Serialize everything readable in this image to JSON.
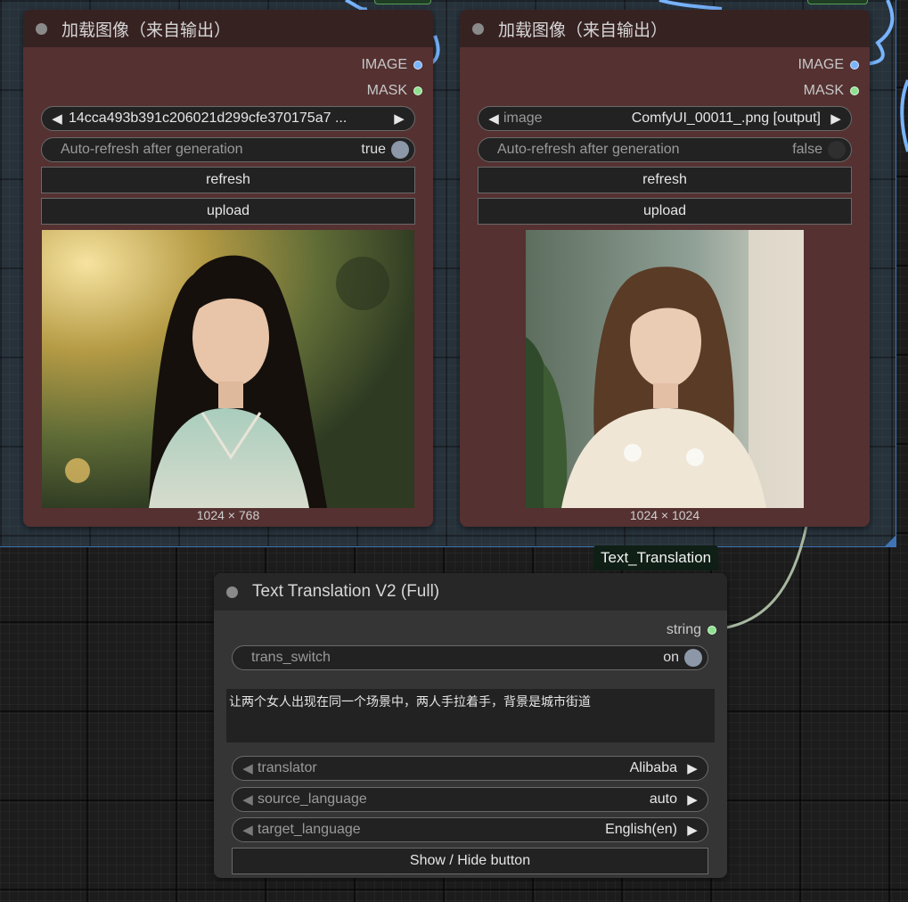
{
  "nodes": {
    "load_image_left": {
      "title": "加载图像（来自输出）",
      "outputs": {
        "image": "IMAGE",
        "mask": "MASK"
      },
      "image_combo": {
        "value": "14cca493b391c206021d299cfe370175a7  ..."
      },
      "auto_refresh": {
        "label": "Auto-refresh after generation",
        "value": "true"
      },
      "refresh_label": "refresh",
      "upload_label": "upload",
      "dimensions": "1024 × 768"
    },
    "load_image_right": {
      "title": "加载图像（来自输出）",
      "outputs": {
        "image": "IMAGE",
        "mask": "MASK"
      },
      "image_combo": {
        "label": "image",
        "value": "ComfyUI_00011_.png [output]"
      },
      "auto_refresh": {
        "label": "Auto-refresh after generation",
        "value": "false"
      },
      "refresh_label": "refresh",
      "upload_label": "upload",
      "dimensions": "1024 × 1024"
    },
    "text_translation": {
      "badge": "Text_Translation",
      "title": "Text Translation V2 (Full)",
      "output": "string",
      "trans_switch": {
        "label": "trans_switch",
        "value": "on"
      },
      "text": "让两个女人出现在同一个场景中，两人手拉着手，背景是城市街道",
      "translator": {
        "label": "translator",
        "value": "Alibaba"
      },
      "source_language": {
        "label": "source_language",
        "value": "auto"
      },
      "target_language": {
        "label": "target_language",
        "value": "English(en)"
      },
      "show_hide_label": "Show / Hide button"
    }
  },
  "icons": {
    "arrow_left": "◀",
    "arrow_right": "▶"
  },
  "colors": {
    "image_node_body": "#553131",
    "image_node_title": "#372222",
    "image_link": "#78b4ff",
    "mask_link": "#8ee090",
    "string_link": "#a7b8a0",
    "group_border": "#3f74b6"
  }
}
